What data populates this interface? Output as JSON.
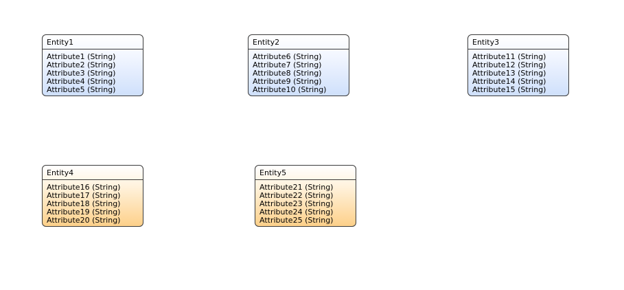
{
  "colors": {
    "blue_gradient_end": "#cfe0fb",
    "orange_gradient_end": "#fdd08a",
    "border": "#3a3a3a"
  },
  "entities": [
    {
      "name": "Entity1",
      "attributes": [
        "Attribute1 (String)",
        "Attribute2 (String)",
        "Attribute3 (String)",
        "Attribute4 (String)",
        "Attribute5 (String)"
      ]
    },
    {
      "name": "Entity2",
      "attributes": [
        "Attribute6 (String)",
        "Attribute7 (String)",
        "Attribute8 (String)",
        "Attribute9 (String)",
        "Attribute10 (String)"
      ]
    },
    {
      "name": "Entity3",
      "attributes": [
        "Attribute11 (String)",
        "Attribute12 (String)",
        "Attribute13 (String)",
        "Attribute14 (String)",
        "Attribute15 (String)"
      ]
    },
    {
      "name": "Entity4",
      "attributes": [
        "Attribute16 (String)",
        "Attribute17 (String)",
        "Attribute18 (String)",
        "Attribute19 (String)",
        "Attribute20 (String)"
      ]
    },
    {
      "name": "Entity5",
      "attributes": [
        "Attribute21 (String)",
        "Attribute22 (String)",
        "Attribute23 (String)",
        "Attribute24 (String)",
        "Attribute25 (String)"
      ]
    }
  ]
}
